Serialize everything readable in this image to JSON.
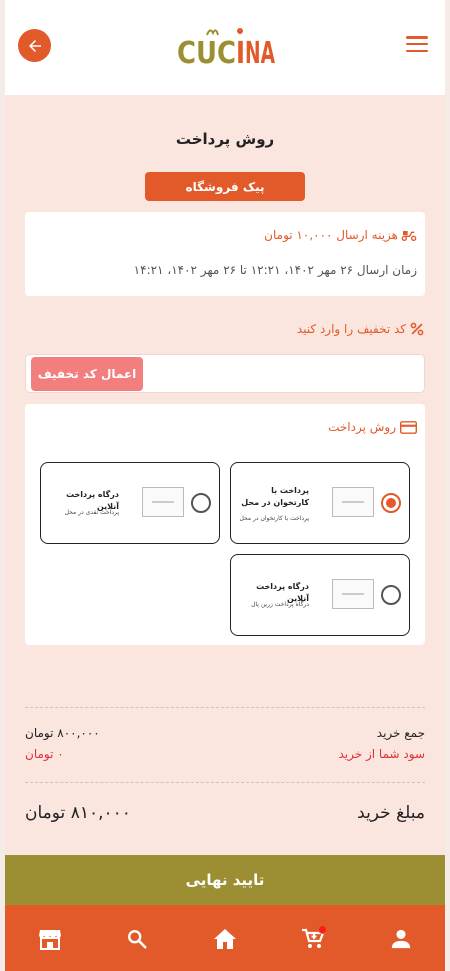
{
  "header": {
    "logo_text": "CUCINA"
  },
  "page": {
    "title": "روش پرداخت",
    "delivery_method": "پیک فروشگاه"
  },
  "shipping": {
    "fee_text": "هزینه ارسال ۱۰,۰۰۰ تومان",
    "time_text": "زمان ارسال ۲۶ مهر ۱۴۰۲، ۱۲:۲۱ تا ۲۶ مهر ۱۴۰۲، ۱۴:۲۱"
  },
  "discount": {
    "label": "کد تخفیف را وارد کنید",
    "placeholder": "",
    "apply_label": "اعمال کد تخفیف"
  },
  "payment": {
    "title": "روش پرداخت",
    "options": [
      {
        "title": "پرداخت با کارتخوان در محل",
        "subtitle": "پرداخت با کارتخوان در محل",
        "selected": true
      },
      {
        "title": "درگاه پرداخت آنلاین",
        "subtitle": "پرداخت نقدی در محل",
        "selected": false
      },
      {
        "title": "درگاه پرداخت آنلاین",
        "subtitle": "درگاه پرداخت زرین پال",
        "selected": false
      }
    ]
  },
  "summary": {
    "subtotal_label": "جمع خرید",
    "subtotal_value": "۸۰۰,۰۰۰ تومان",
    "savings_label": "سود شما از خرید",
    "savings_value": "۰ تومان",
    "total_label": "مبلغ خرید",
    "total_value": "۸۱۰,۰۰۰ تومان"
  },
  "confirm_label": "تایید نهایی",
  "colors": {
    "accent": "#e25a2a",
    "confirm": "#9c8f33",
    "apply": "#f27e7e",
    "panel": "#fbe6df",
    "savings": "#e0303a"
  },
  "nav": [
    {
      "icon": "store-icon"
    },
    {
      "icon": "search-icon"
    },
    {
      "icon": "home-icon"
    },
    {
      "icon": "cart-icon",
      "badge": true
    },
    {
      "icon": "user-icon"
    }
  ]
}
